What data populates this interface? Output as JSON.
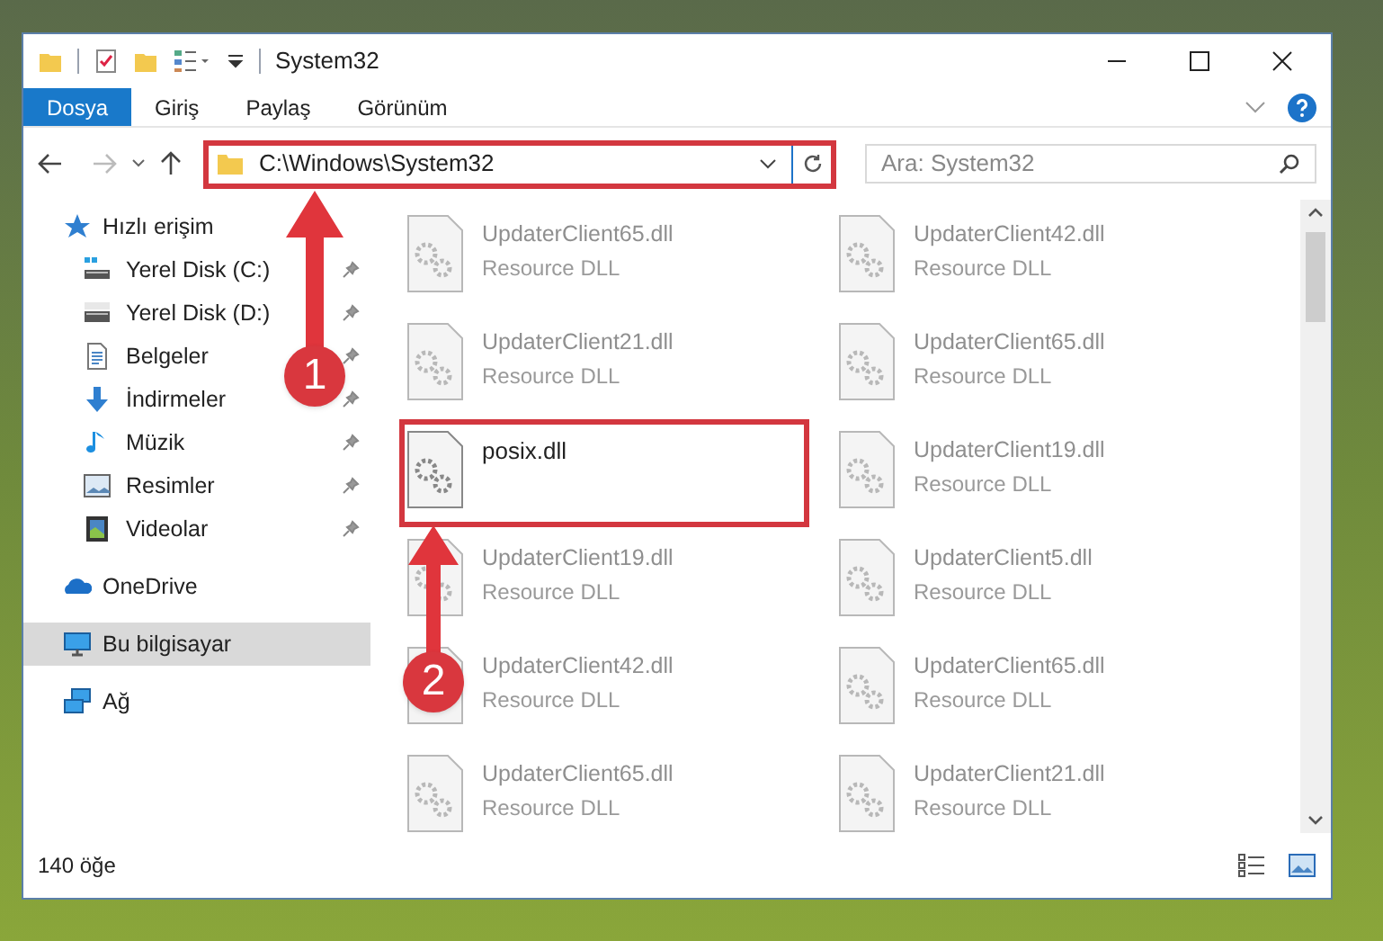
{
  "window": {
    "title": "System32"
  },
  "ribbon_tabs": [
    {
      "label": "Dosya",
      "selected": true
    },
    {
      "label": "Giriş",
      "selected": false
    },
    {
      "label": "Paylaş",
      "selected": false
    },
    {
      "label": "Görünüm",
      "selected": false
    }
  ],
  "address": {
    "value": "C:\\Windows\\System32"
  },
  "search": {
    "placeholder": "Ara: System32"
  },
  "nav": [
    {
      "label": "Hızlı erişim",
      "selected": false,
      "children": [
        {
          "label": "Yerel Disk (C:)",
          "pinned": true
        },
        {
          "label": "Yerel Disk (D:)",
          "pinned": true
        },
        {
          "label": "Belgeler",
          "pinned": true
        },
        {
          "label": "İndirmeler",
          "pinned": true
        },
        {
          "label": "Müzik",
          "pinned": true
        },
        {
          "label": "Resimler",
          "pinned": true
        },
        {
          "label": "Videolar",
          "pinned": true
        }
      ]
    },
    {
      "label": "OneDrive",
      "selected": false
    },
    {
      "label": "Bu bilgisayar",
      "selected": true
    },
    {
      "label": "Ağ",
      "selected": false
    }
  ],
  "files": [
    {
      "name": "UpdaterClient65.dll",
      "type": "Resource DLL",
      "blurred": true
    },
    {
      "name": "UpdaterClient42.dll",
      "type": "Resource DLL",
      "blurred": true
    },
    {
      "name": "UpdaterClient21.dll",
      "type": "Resource DLL",
      "blurred": true
    },
    {
      "name": "UpdaterClient65.dll",
      "type": "Resource DLL",
      "blurred": true
    },
    {
      "name": "posix.dll",
      "blurred": false
    },
    {
      "name": "UpdaterClient19.dll",
      "type": "Resource DLL",
      "blurred": true
    },
    {
      "name": "UpdaterClient19.dll",
      "type": "Resource DLL",
      "blurred": true
    },
    {
      "name": "UpdaterClient5.dll",
      "type": "Resource DLL",
      "blurred": true
    },
    {
      "name": "UpdaterClient42.dll",
      "type": "Resource DLL",
      "blurred": true
    },
    {
      "name": "UpdaterClient65.dll",
      "type": "Resource DLL",
      "blurred": true
    },
    {
      "name": "UpdaterClient65.dll",
      "type": "Resource DLL",
      "blurred": true
    },
    {
      "name": "UpdaterClient21.dll",
      "type": "Resource DLL",
      "blurred": true
    }
  ],
  "status_bar": {
    "count": "140 öğe"
  },
  "annotations": [
    {
      "number": "1"
    },
    {
      "number": "2"
    }
  ]
}
